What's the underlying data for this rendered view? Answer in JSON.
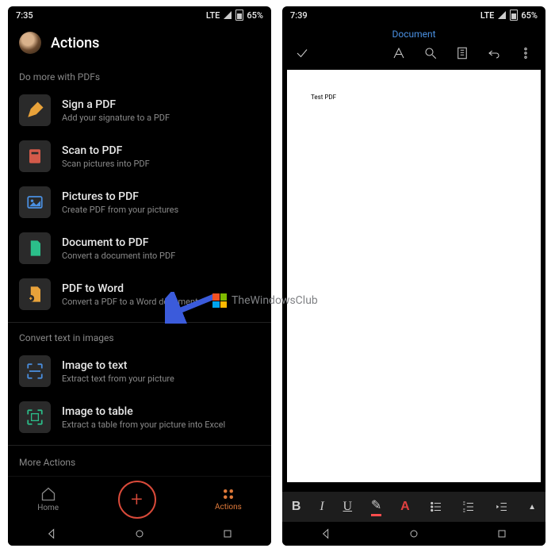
{
  "left": {
    "time": "7:35",
    "status_lte": "LTE",
    "status_batt": "65%",
    "title": "Actions",
    "section1": "Do more with PDFs",
    "actions1": [
      {
        "name": "sign-a-pdf",
        "icon": "pen-orange",
        "title": "Sign a PDF",
        "sub": "Add your signature to a PDF"
      },
      {
        "name": "scan-to-pdf",
        "icon": "scan-red",
        "title": "Scan to PDF",
        "sub": "Scan pictures into PDF"
      },
      {
        "name": "pictures-to-pdf",
        "icon": "image-blue",
        "title": "Pictures to PDF",
        "sub": "Create PDF from your pictures"
      },
      {
        "name": "document-to-pdf",
        "icon": "doc-green",
        "title": "Document to PDF",
        "sub": "Convert a document into PDF"
      },
      {
        "name": "pdf-to-word",
        "icon": "word-orange",
        "title": "PDF to Word",
        "sub": "Convert a PDF to a Word document"
      }
    ],
    "section2": "Convert text in images",
    "actions2": [
      {
        "name": "image-to-text",
        "icon": "ocr-blue",
        "title": "Image to text",
        "sub": "Extract text from your picture"
      },
      {
        "name": "image-to-table",
        "icon": "ocr-green",
        "title": "Image to table",
        "sub": "Extract a table from your picture into Excel"
      }
    ],
    "section3": "More Actions",
    "appbar": {
      "home": "Home",
      "actions": "Actions"
    }
  },
  "right": {
    "time": "7:39",
    "status_lte": "LTE",
    "status_batt": "65%",
    "doc_label": "Document",
    "page_text": "Test PDF"
  },
  "watermark": "TheWindowsClub"
}
